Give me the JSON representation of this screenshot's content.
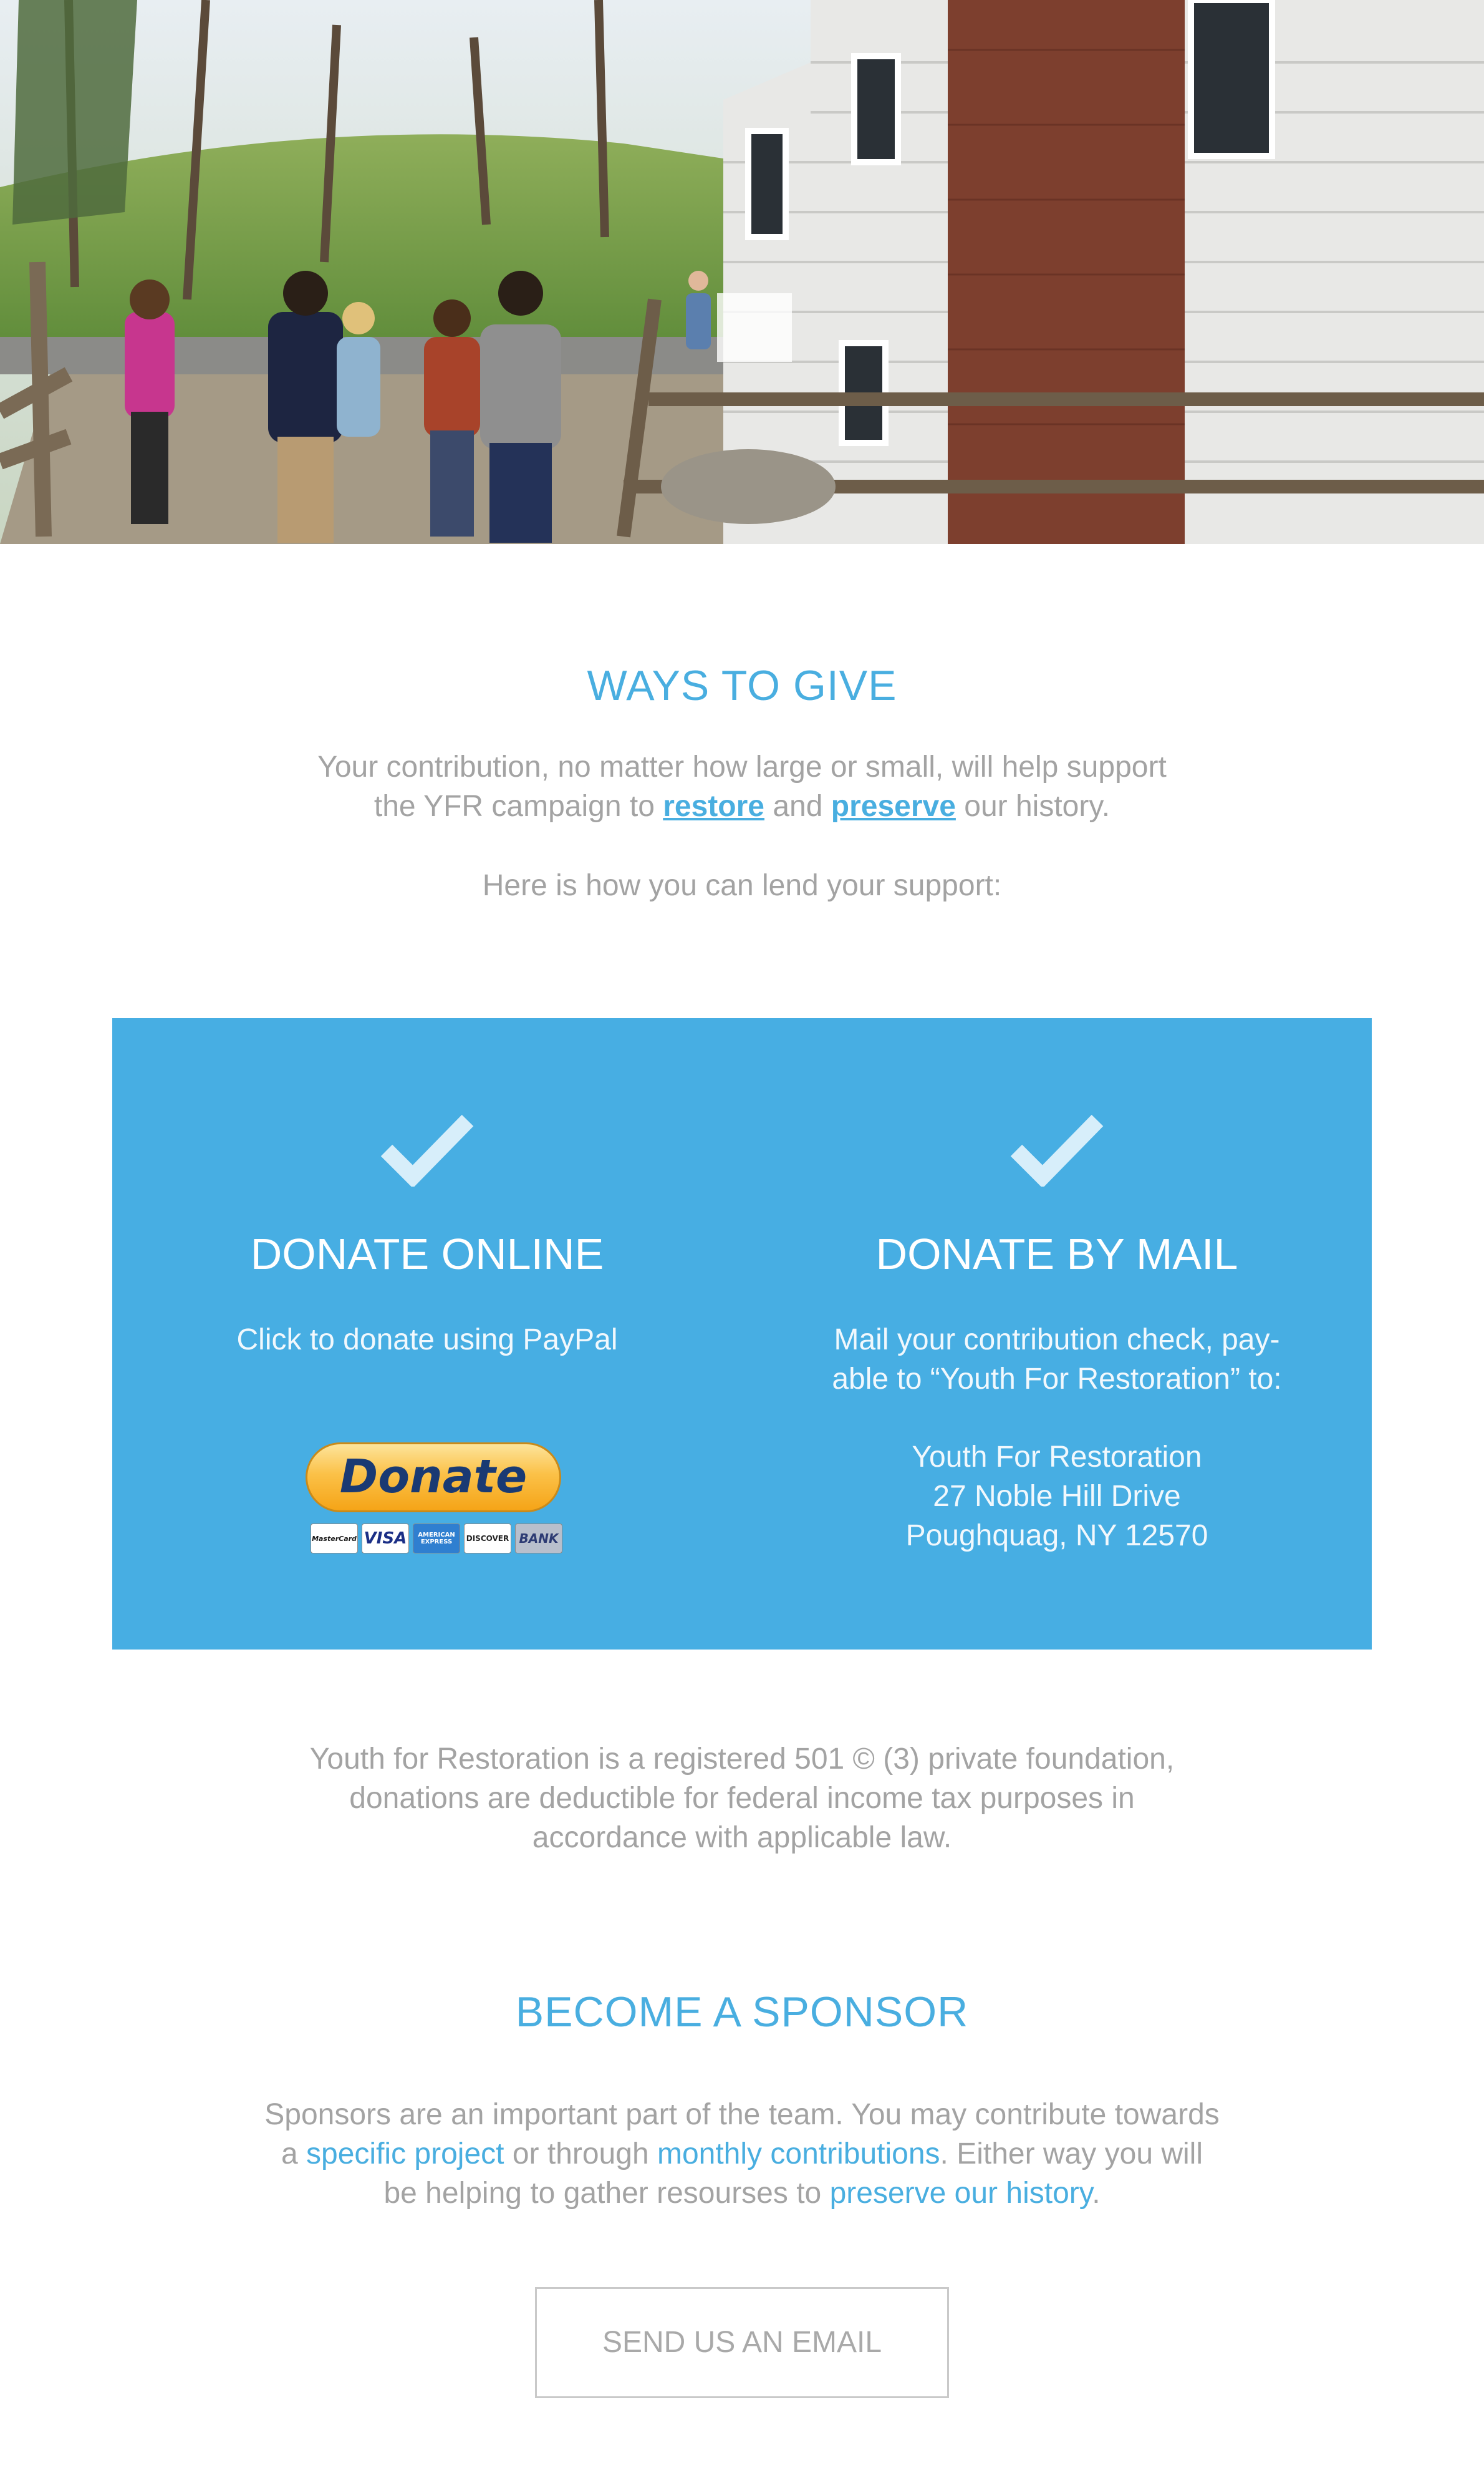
{
  "ways_to_give": {
    "title": "WAYS TO GIVE",
    "intro_line1": "Your contribution, no matter how large or small, will help support",
    "intro_line2_a": "the YFR campaign to ",
    "intro_line2_restore": "restore",
    "intro_line2_and": " and ",
    "intro_line2_preserve": "preserve",
    "intro_line2_b": " our history.",
    "support_line": "Here is how you can lend your support:"
  },
  "donate_online": {
    "title": "DONATE ONLINE",
    "subtitle": "Click to donate using PayPal",
    "button_label": "Donate",
    "cards": [
      "MasterCard",
      "VISA",
      "AMERICAN EXPRESS",
      "DISCOVER",
      "BANK"
    ]
  },
  "donate_mail": {
    "title": "DONATE BY MAIL",
    "line1": "Mail your contribution check, pay-",
    "line2": "able to “Youth For Restoration” to:",
    "address_name": "Youth For Restoration",
    "address_street": "27 Noble Hill Drive",
    "address_city": "Poughquag, NY 12570"
  },
  "tax_note": {
    "line1": "Youth for Restoration is a registered 501 © (3) private foundation,",
    "line2": "donations are deductible for federal income tax purposes in",
    "line3": "accordance with applicable law."
  },
  "sponsor": {
    "title": "BECOME A SPONSOR",
    "line1": "Sponsors are an important part of the team. You may contribute towards",
    "line2_a": "a ",
    "line2_link1": "specific project",
    "line2_b": " or through ",
    "line2_link2": "monthly contributions",
    "line2_c": ". Either way you will",
    "line3_a": "be helping to gather resourses to ",
    "line3_link": "preserve our history",
    "line3_b": ".",
    "email_button": "SEND US AN EMAIL"
  },
  "colors": {
    "accent": "#49aee0",
    "donate_box": "#47aee3",
    "body_text": "#a3a3a3"
  }
}
